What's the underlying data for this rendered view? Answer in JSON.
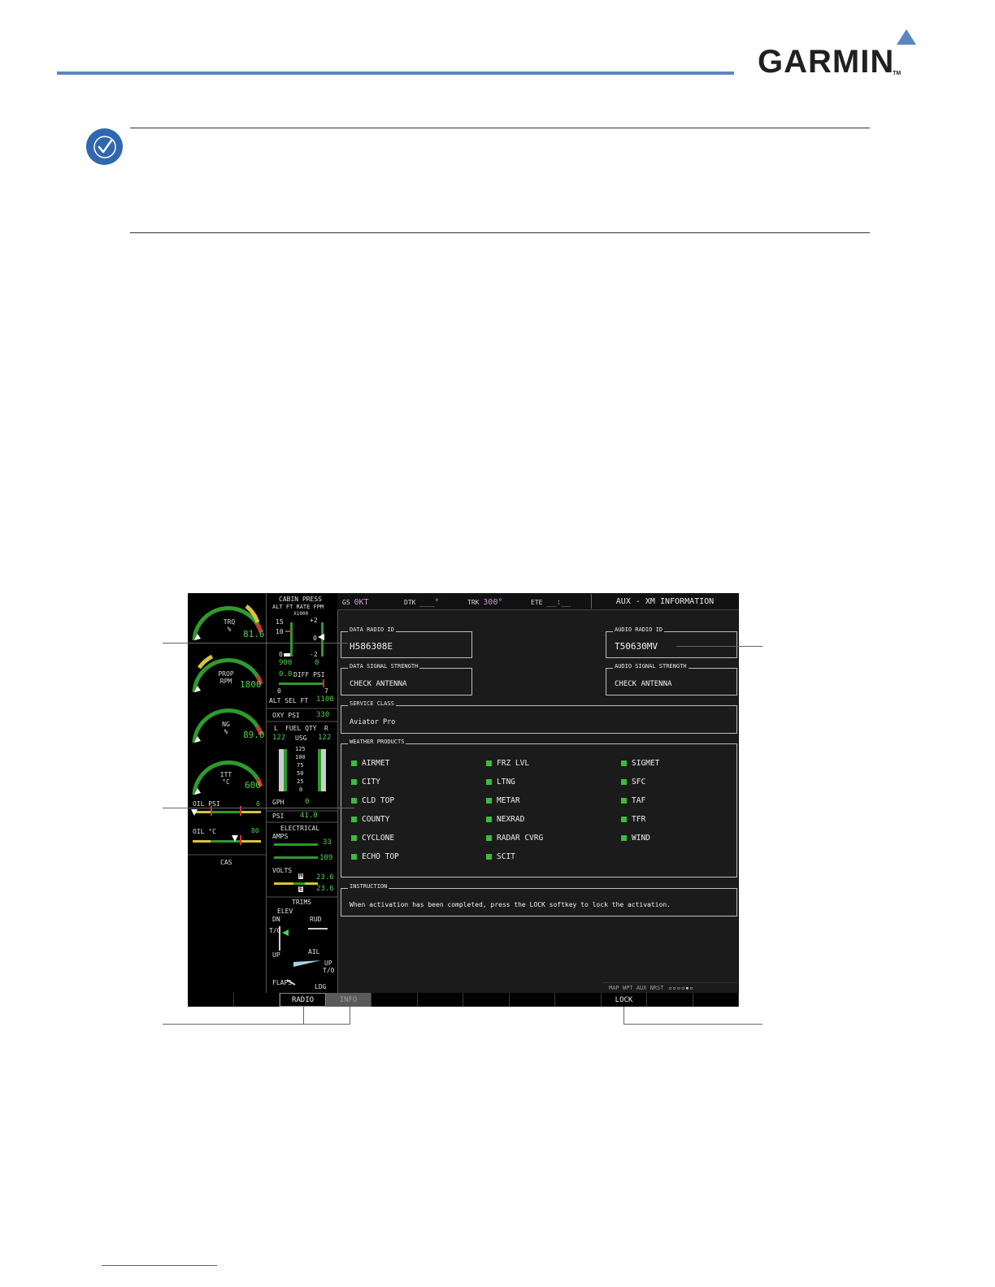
{
  "brand": {
    "name": "GARMIN",
    "tm": "TM",
    "color": "#5b86c0"
  },
  "eis": {
    "trq": {
      "label": "TRQ",
      "unit": "%",
      "value": "81.6"
    },
    "prop": {
      "label": "PROP",
      "unit": "RPM",
      "value": "1800"
    },
    "ng": {
      "label": "NG",
      "unit": "%",
      "value": "89.0"
    },
    "itt": {
      "label": "ITT",
      "unit": "°C",
      "value": "600"
    },
    "oil_psi": {
      "label": "OIL PSI",
      "value": "0"
    },
    "oil_c": {
      "label": "OIL °C",
      "value": "80"
    },
    "cas": "CAS",
    "cabin": {
      "title": "CABIN PRESS",
      "subtitle": "ALT FT  RATE FPM",
      "x1000": "X1000",
      "alt_15": "15",
      "alt_10": "10",
      "alt_0": "0",
      "alt_val": "900",
      "rate_p2": "+2",
      "rate_0": "0",
      "rate_m2": "-2",
      "rate_val": "0",
      "diff_val": "0.0",
      "diff_label": "DIFF PSI",
      "diff_min": "0",
      "diff_max": "7",
      "alt_sel_label": "ALT SEL FT",
      "alt_sel_val": "1100"
    },
    "oxy": {
      "label": "OXY PSI",
      "value": "330"
    },
    "fuel": {
      "l": "L",
      "title": "FUEL QTY",
      "r": "R",
      "l_val": "122",
      "unit": "USG",
      "r_val": "122",
      "scale": [
        "125",
        "100",
        "75",
        "50",
        "25",
        "0"
      ],
      "gph_label": "GPH",
      "gph_val": "0",
      "psi_label": "PSI",
      "psi_val": "41.0"
    },
    "electrical": {
      "title": "ELECTRICAL",
      "amps": "AMPS",
      "amps1": "33",
      "amps2": "109",
      "volts": "VOLTS",
      "v1": "23.6",
      "v2": "23.6",
      "m": "M",
      "e": "E",
      "s": "S"
    },
    "trims": {
      "title": "TRIMS",
      "elev": "ELEV",
      "dn": "DN",
      "to": "T/O",
      "up": "UP",
      "rud": "RUD",
      "ail": "AIL",
      "up2": "UP",
      "to2": "T/O",
      "flaps": "FLAPS",
      "ldg": "LDG"
    }
  },
  "nav": {
    "gs_label": "GS",
    "gs_val": "0KT",
    "dtk_label": "DTK",
    "dtk_val": "___°",
    "trk_label": "TRK",
    "trk_val": "300°",
    "ete_label": "ETE",
    "ete_val": "__:__"
  },
  "page_title": "AUX - XM INFORMATION",
  "data_radio_id": {
    "label": "DATA RADIO ID",
    "value": "H586308E"
  },
  "audio_radio_id": {
    "label": "AUDIO RADIO ID",
    "value": "T50630MV"
  },
  "data_signal": {
    "label": "DATA SIGNAL STRENGTH",
    "value": "CHECK ANTENNA"
  },
  "audio_signal": {
    "label": "AUDIO SIGNAL STRENGTH",
    "value": "CHECK ANTENNA"
  },
  "service_class": {
    "label": "SERVICE CLASS",
    "value": "Aviator Pro"
  },
  "weather_products": {
    "label": "WEATHER PRODUCTS",
    "col1": [
      "AIRMET",
      "CITY",
      "CLD TOP",
      "COUNTY",
      "CYCLONE",
      "ECHO TOP"
    ],
    "col2": [
      "FRZ LVL",
      "LTNG",
      "METAR",
      "NEXRAD",
      "RADAR CVRG",
      "SCIT"
    ],
    "col3": [
      "SIGMET",
      "SFC",
      "TAF",
      "TFR",
      "WIND"
    ]
  },
  "instruction": {
    "label": "INSTRUCTION",
    "value": "When activation has been completed, press the LOCK softkey to lock the activation."
  },
  "page_nav": {
    "text": "MAP WPT AUX NRST"
  },
  "softkeys": [
    "",
    "",
    "RADIO",
    "INFO",
    "",
    "",
    "",
    "",
    "",
    "LOCK",
    "",
    ""
  ]
}
